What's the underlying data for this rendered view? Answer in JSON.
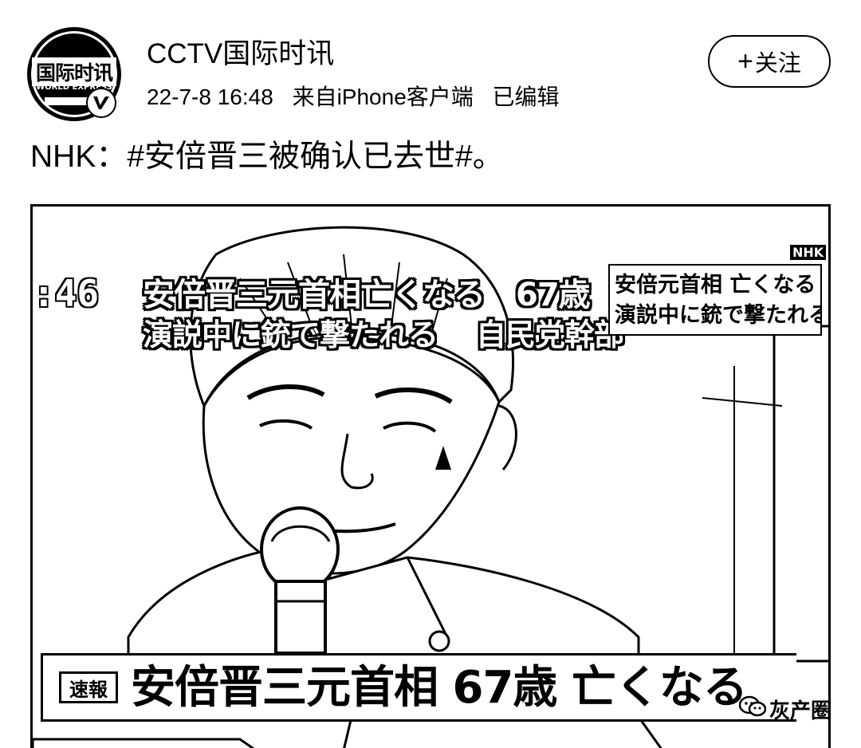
{
  "account": {
    "name": "CCTV国际时讯",
    "avatar_logo_cn": "国际时讯",
    "avatar_logo_en": "WORLD EXPRESS",
    "verified_icon": "verified-badge-icon"
  },
  "meta": {
    "timestamp": "22-7-8 16:48",
    "source": "来自iPhone客户端",
    "edited": "已编辑"
  },
  "follow_button": {
    "label": "关注",
    "icon": "plus-icon"
  },
  "post": {
    "text": "NHK：#安倍晋三被确认已去世#。"
  },
  "media": {
    "timecode": ":46",
    "caption_line1": "安倍晋三元首相亡くなる　67歳",
    "caption_line2": "演説中に銃で撃たれる",
    "caption_line2_right": "自民党幹部",
    "side_box_line1": "安倍元首相 亡くなる",
    "side_box_line2": "演説中に銃で撃たれる",
    "channel_mark": "NHK",
    "breaking_label": "速報",
    "bottom_headline": "安倍晋三元首相 67歳 亡くなる",
    "watermark": "灰产圈",
    "watermark_icon": "wechat-icon"
  }
}
